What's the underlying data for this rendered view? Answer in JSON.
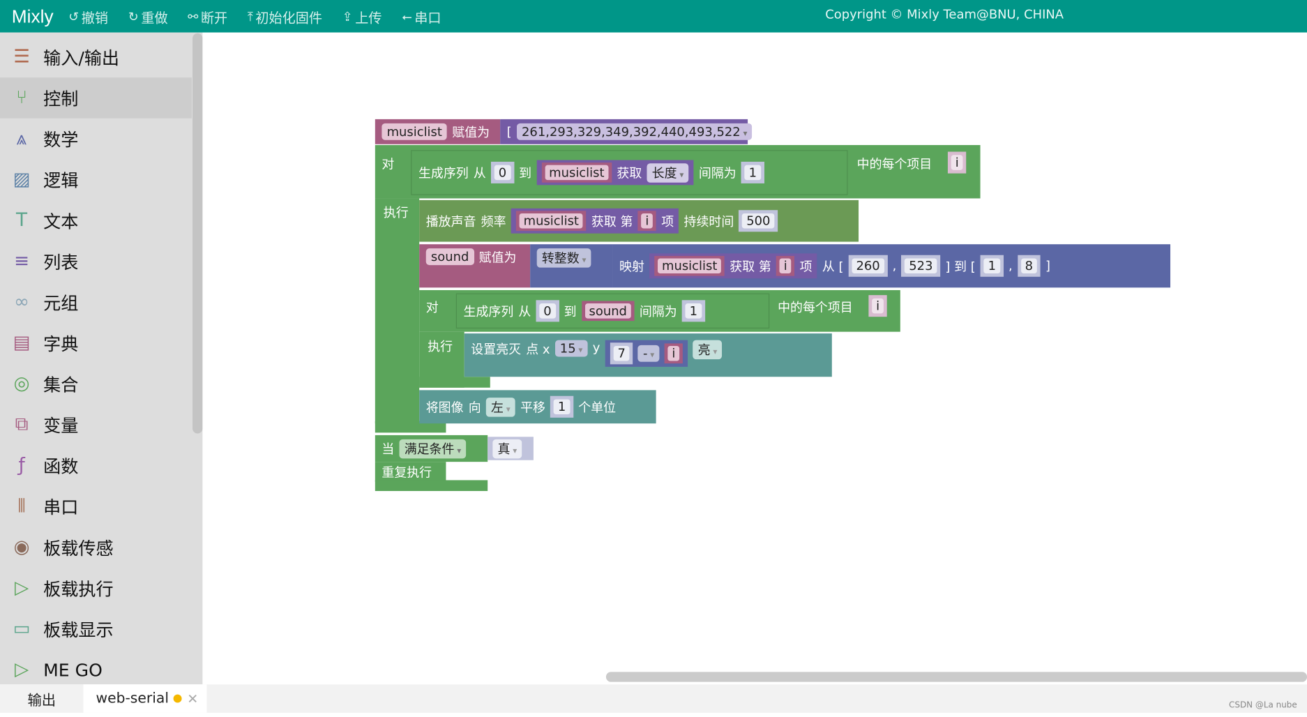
{
  "topbar": {
    "logo": "Mixly",
    "buttons": [
      {
        "icon": "undo-icon",
        "label": "撤销"
      },
      {
        "icon": "redo-icon",
        "label": "重做"
      },
      {
        "icon": "disconnect-icon",
        "label": "断开"
      },
      {
        "icon": "upload-firmware-icon",
        "label": "初始化固件"
      },
      {
        "icon": "upload-icon",
        "label": "上传"
      },
      {
        "icon": "usb-icon",
        "label": "串口"
      }
    ],
    "copyright": "Copyright © Mixly Team@BNU, CHINA",
    "color": "#009688"
  },
  "sidebar": {
    "selected": "控制",
    "items": [
      {
        "label": "输入/输出",
        "icon": "io-icon"
      },
      {
        "label": "控制",
        "icon": "control-icon"
      },
      {
        "label": "数学",
        "icon": "math-icon"
      },
      {
        "label": "逻辑",
        "icon": "logic-icon"
      },
      {
        "label": "文本",
        "icon": "text-icon"
      },
      {
        "label": "列表",
        "icon": "list-icon"
      },
      {
        "label": "元组",
        "icon": "tuple-icon"
      },
      {
        "label": "字典",
        "icon": "dict-icon"
      },
      {
        "label": "集合",
        "icon": "set-icon"
      },
      {
        "label": "变量",
        "icon": "variable-icon"
      },
      {
        "label": "函数",
        "icon": "function-icon"
      },
      {
        "label": "串口",
        "icon": "serial-icon"
      },
      {
        "label": "板载传感",
        "icon": "sensor-icon"
      },
      {
        "label": "板载执行",
        "icon": "actuator-icon"
      },
      {
        "label": "板载显示",
        "icon": "display-icon"
      },
      {
        "label": "ME GO",
        "icon": "mego-icon"
      }
    ]
  },
  "blocks": {
    "assign1": {
      "var": "musiclist",
      "op": "赋值为",
      "lb": "[",
      "list": "261,293,329,349,392,440,493,522",
      "rb": "]"
    },
    "for1": {
      "for": "对",
      "range": "生成序列",
      "from": "从",
      "from_v": "0",
      "to": "到",
      "list_var": "musiclist",
      "get": "获取",
      "len": "长度",
      "step": "间隔为",
      "step_v": "1",
      "each": "中的每个项目",
      "iter": "i",
      "do": "执行"
    },
    "tone": {
      "label": "播放声音",
      "freq": "频率",
      "list_var": "musiclist",
      "get": "获取 第",
      "idx": "i",
      "item": "项",
      "dur": "持续时间",
      "dur_v": "500"
    },
    "assign2": {
      "var": "sound",
      "op": "赋值为",
      "conv": "转整数",
      "map": "映射",
      "list_var": "musiclist",
      "get": "获取 第",
      "idx": "i",
      "item": "项",
      "from": "从 [",
      "a": "260",
      "comma": ",",
      "b": "523",
      "to": "] 到 [",
      "c": "1",
      "d": "8",
      "end": "]"
    },
    "for2": {
      "for": "对",
      "range": "生成序列",
      "from": "从",
      "from_v": "0",
      "to": "到",
      "to_var": "sound",
      "step": "间隔为",
      "step_v": "1",
      "each": "中的每个项目",
      "iter": "i",
      "do": "执行"
    },
    "pixel": {
      "label": "设置亮灭",
      "x": "点 x",
      "x_v": "15",
      "y": "y",
      "y_a": "7",
      "y_op": "-",
      "y_b": "i",
      "state": "亮"
    },
    "shift": {
      "label": "将图像",
      "dir": "向",
      "dir_v": "左",
      "move": "平移",
      "n": "1",
      "unit": "个单位"
    },
    "while": {
      "label": "当",
      "cond": "满足条件",
      "val": "真",
      "repeat": "重复执行"
    }
  },
  "bottom": {
    "tabs": [
      {
        "label": "输出"
      },
      {
        "label": "web-serial",
        "status_color": "#f5b800"
      }
    ],
    "watermark": "CSDN @La nube"
  }
}
